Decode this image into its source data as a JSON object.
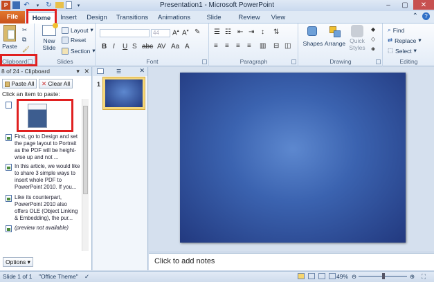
{
  "window": {
    "title": "Presentation1  -  Microsoft PowerPoint"
  },
  "tabs": [
    "File",
    "Home",
    "Insert",
    "Design",
    "Transitions",
    "Animations",
    "Slide Show",
    "Review",
    "View"
  ],
  "ribbon": {
    "clipboard": {
      "label": "Clipboard",
      "paste": "Paste"
    },
    "slides": {
      "label": "Slides",
      "new_slide": "New\nSlide",
      "layout": "Layout",
      "reset": "Reset",
      "section": "Section"
    },
    "font": {
      "label": "Font",
      "size": "44"
    },
    "paragraph": {
      "label": "Paragraph"
    },
    "drawing": {
      "label": "Drawing",
      "shapes": "Shapes",
      "arrange": "Arrange",
      "quick_styles": "Quick\nStyles"
    },
    "editing": {
      "label": "Editing",
      "find": "Find",
      "replace": "Replace",
      "select": "Select"
    }
  },
  "clipboard_pane": {
    "header": "8 of 24 - Clipboard",
    "paste_all": "Paste All",
    "clear_all": "Clear All",
    "instruction": "Click an item to paste:",
    "items": [
      "First, go to Design and set the page layout to Portrait as the PDF will be height-wise up and not ...",
      "In this article, we would like to share 3 simple ways to insert whole PDF to PowerPoint 2010. If you...",
      "Like its counterpart, PowerPoint 2010 also offers OLE (Object Linking & Embedding), the pur...",
      "(preview not available)"
    ],
    "options": "Options"
  },
  "thumbnails": {
    "slide_number": "1"
  },
  "notes": {
    "placeholder": "Click to add notes"
  },
  "status": {
    "slide": "Slide 1 of 1",
    "theme": "\"Office Theme\"",
    "zoom": "49%"
  }
}
